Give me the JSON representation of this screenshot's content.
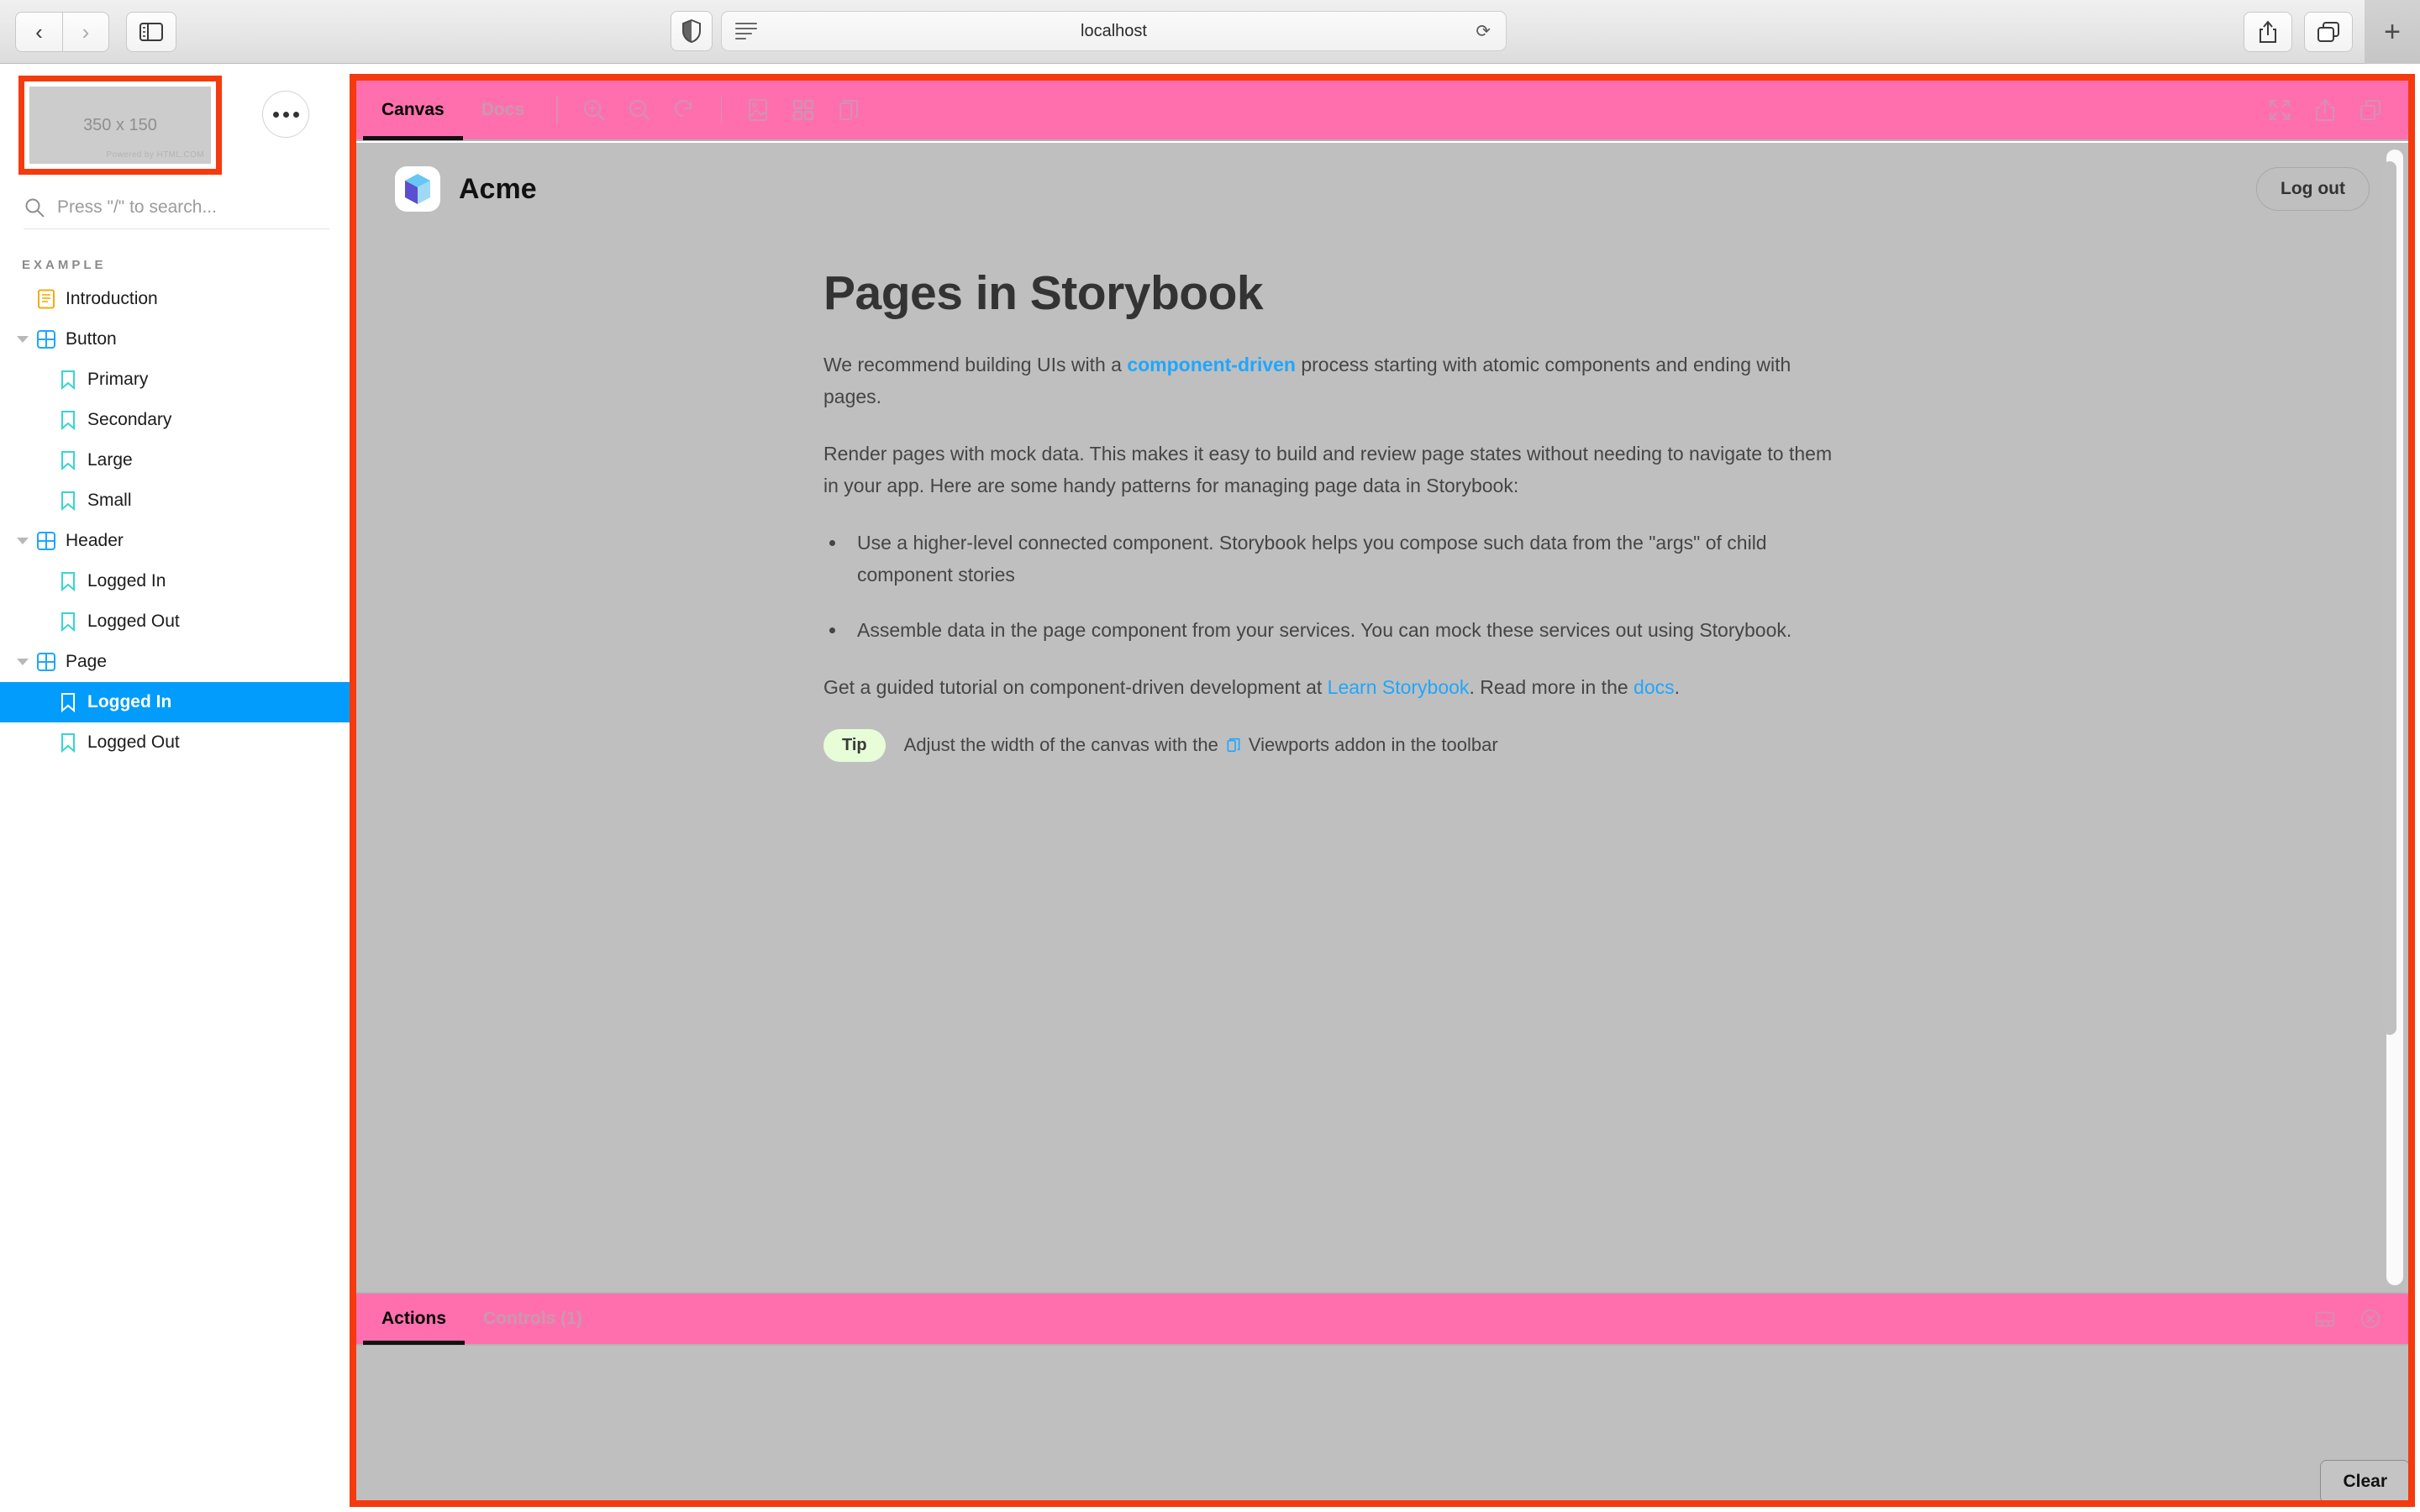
{
  "browser": {
    "back_label": "‹",
    "forward_label": "›",
    "sidebar_toggle_name": "sidebar-toggle",
    "shield_name": "privacy-shield-icon",
    "reader_name": "reader-view-icon",
    "url": "localhost",
    "reload_label": "⟳",
    "share_name": "share-icon",
    "tabs_name": "tab-overview-icon",
    "newtab_label": "+"
  },
  "sidebar": {
    "placeholder": {
      "dimensions_label": "350 x 150",
      "credit": "Powered by HTML.COM"
    },
    "menu_button_name": "sidebar-menu-button",
    "search": {
      "placeholder": "Press \"/\" to search...",
      "value": ""
    },
    "section_heading": "EXAMPLE",
    "tree": [
      {
        "label": "Introduction",
        "depth": 1,
        "icon": "document-icon",
        "expandable": false,
        "selected": false
      },
      {
        "label": "Button",
        "depth": 1,
        "icon": "component-icon",
        "expandable": true,
        "selected": false
      },
      {
        "label": "Primary",
        "depth": 2,
        "icon": "story-icon",
        "expandable": false,
        "selected": false
      },
      {
        "label": "Secondary",
        "depth": 2,
        "icon": "story-icon",
        "expandable": false,
        "selected": false
      },
      {
        "label": "Large",
        "depth": 2,
        "icon": "story-icon",
        "expandable": false,
        "selected": false
      },
      {
        "label": "Small",
        "depth": 2,
        "icon": "story-icon",
        "expandable": false,
        "selected": false
      },
      {
        "label": "Header",
        "depth": 1,
        "icon": "component-icon",
        "expandable": true,
        "selected": false
      },
      {
        "label": "Logged In",
        "depth": 2,
        "icon": "story-icon",
        "expandable": false,
        "selected": false
      },
      {
        "label": "Logged Out",
        "depth": 2,
        "icon": "story-icon",
        "expandable": false,
        "selected": false
      },
      {
        "label": "Page",
        "depth": 1,
        "icon": "component-icon",
        "expandable": true,
        "selected": false
      },
      {
        "label": "Logged In",
        "depth": 2,
        "icon": "story-icon",
        "expandable": false,
        "selected": true
      },
      {
        "label": "Logged Out",
        "depth": 2,
        "icon": "story-icon",
        "expandable": false,
        "selected": false
      }
    ]
  },
  "toolbar": {
    "tabs": [
      {
        "label": "Canvas",
        "active": true
      },
      {
        "label": "Docs",
        "active": false
      }
    ],
    "icons_left": [
      "zoom-in-icon",
      "zoom-out-icon",
      "zoom-reset-icon"
    ],
    "icons_addons": [
      "backgrounds-icon",
      "grid-icon",
      "viewport-icon"
    ],
    "icons_right": [
      "fullscreen-icon",
      "open-in-new-tab-icon",
      "copy-link-icon"
    ]
  },
  "story": {
    "brand_name": "Acme",
    "brand_logo_name": "acme-cube-logo",
    "logout_label": "Log out",
    "title": "Pages in Storybook",
    "p1_before": "We recommend building UIs with a ",
    "p1_link": "component-driven",
    "p1_after": " process starting with atomic components and ending with pages.",
    "p2": "Render pages with mock data. This makes it easy to build and review page states without needing to navigate to them in your app. Here are some handy patterns for managing page data in Storybook:",
    "bullets": [
      "Use a higher-level connected component. Storybook helps you compose such data from the \"args\" of child component stories",
      "Assemble data in the page component from your services. You can mock these services out using Storybook."
    ],
    "p3_before": "Get a guided tutorial on component-driven development at ",
    "p3_link1": "Learn Storybook",
    "p3_middle": ". Read more in the ",
    "p3_link2": "docs",
    "p3_after": ".",
    "tip_badge": "Tip",
    "tip_before": "Adjust the width of the canvas with the ",
    "tip_after": " Viewports addon in the toolbar"
  },
  "panel": {
    "tabs": [
      {
        "label": "Actions",
        "active": true
      },
      {
        "label": "Controls (1)",
        "active": false
      }
    ],
    "icons_right": [
      "panel-position-icon",
      "close-panel-icon"
    ],
    "clear_label": "Clear"
  },
  "colors": {
    "accent_pink": "#ff6fae",
    "highlight_red": "#f53a0e",
    "selection_blue": "#029cfd",
    "link_blue": "#1ea7fd",
    "canvas_gray": "#bfbfbf",
    "tip_green": "#e7fdd8"
  }
}
